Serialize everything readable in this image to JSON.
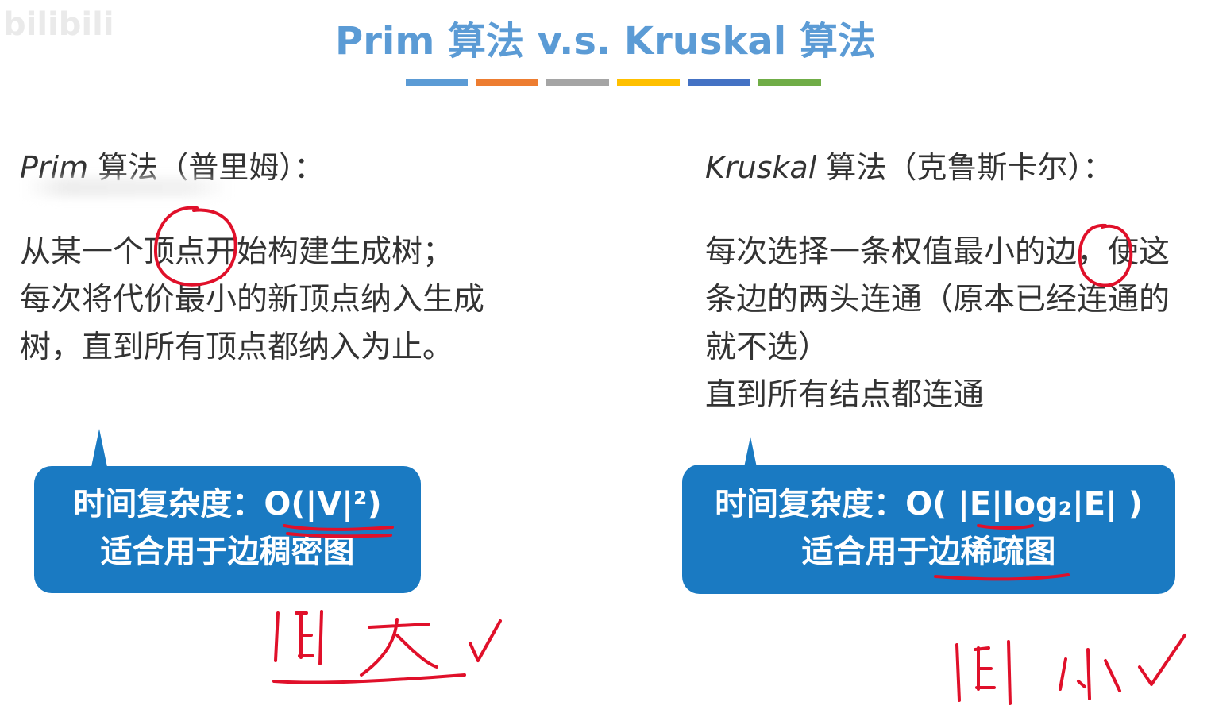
{
  "slide": {
    "title": "Prim 算法 v.s. Kruskal 算法",
    "color_bar": [
      "#5b9bd5",
      "#ed7d31",
      "#a5a5a5",
      "#ffc000",
      "#4472c4",
      "#70ad47"
    ],
    "watermark": "bilibili"
  },
  "prim": {
    "name": "Prim",
    "heading_rest": " 算法（普里姆）：",
    "description": [
      "从某一个顶点开始构建生成树；",
      "每次将代价最小的新顶点纳入生成",
      "树，直到所有顶点都纳入为止。"
    ],
    "callout": {
      "complexity_label": "时间复杂度：",
      "complexity_value": "O(|V|²)",
      "suitability": "适合用于边稠密图"
    },
    "handwritten_note": "|E| 大 ✓"
  },
  "kruskal": {
    "name": "Kruskal",
    "heading_rest": " 算法（克鲁斯卡尔）：",
    "description": [
      "每次选择一条权值最小的边，使这",
      "条边的两头连通（原本已经连通的",
      "就不选）",
      "直到所有结点都连通"
    ],
    "callout": {
      "complexity_label": "时间复杂度：",
      "complexity_value": "O( |E|log₂|E| )",
      "suitability": "适合用于边稀疏图"
    },
    "handwritten_note": "|E| 小 ✓"
  },
  "colors": {
    "title": "#5b9bd5",
    "text": "#333333",
    "callout_bg": "#1a7ac2",
    "ink": "#e0102a"
  }
}
